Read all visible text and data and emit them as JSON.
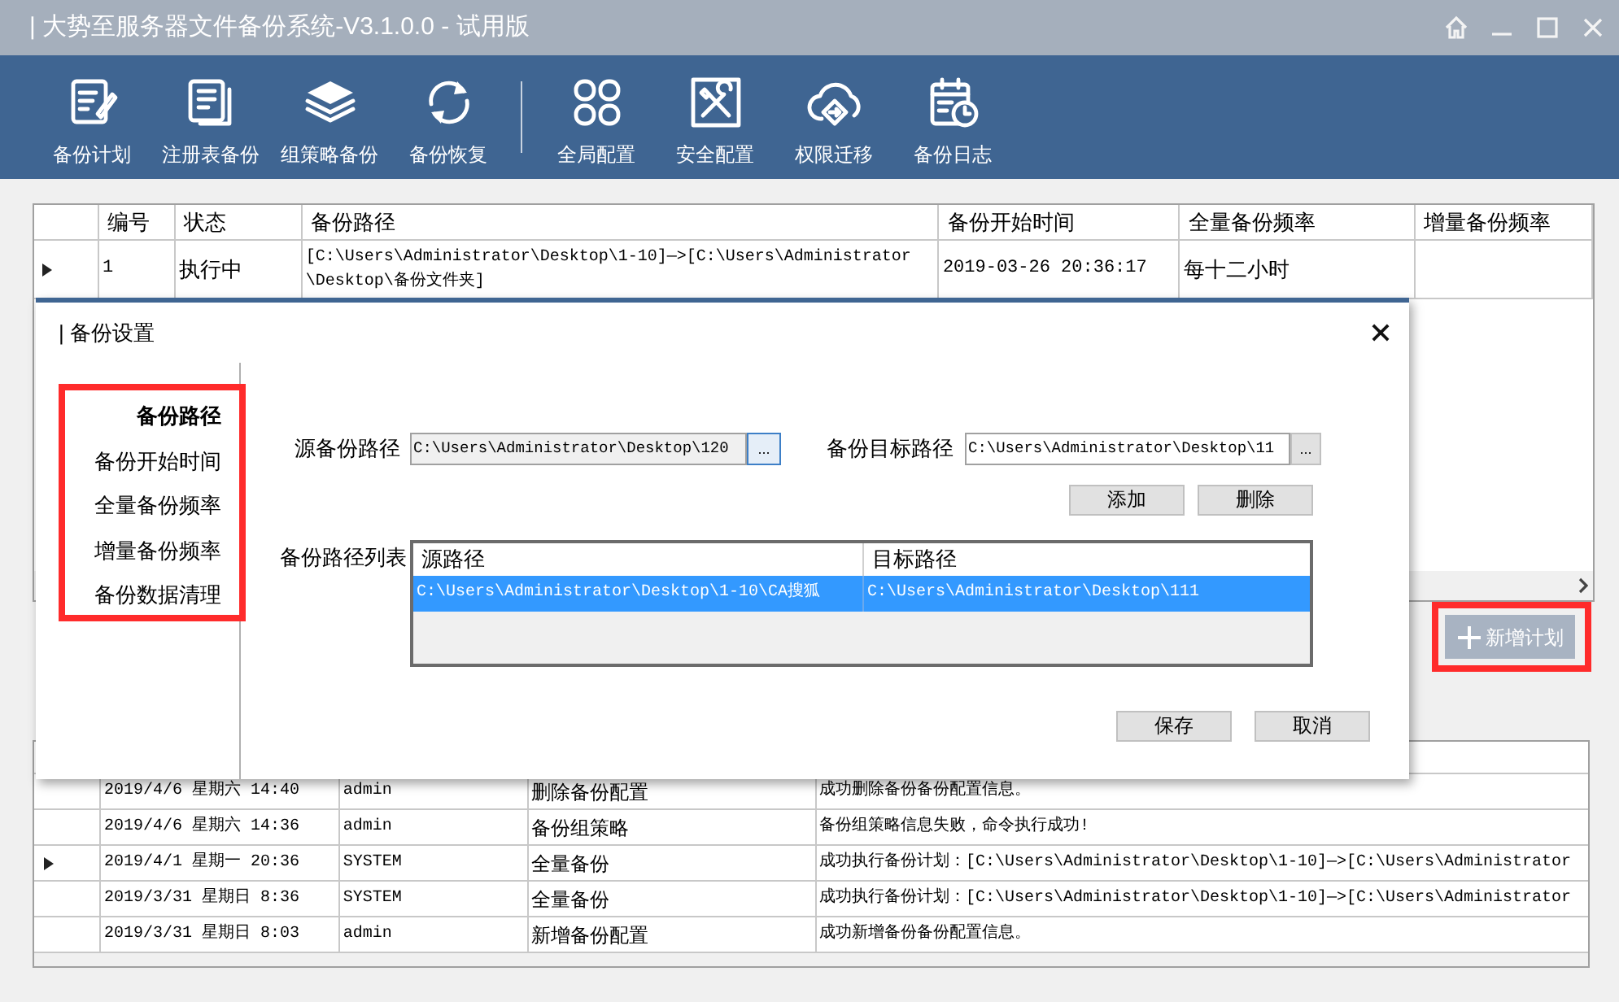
{
  "window": {
    "title": "| 大势至服务器文件备份系统-V3.1.0.0 - 试用版"
  },
  "toolbar": [
    {
      "label": "备份计划",
      "kind": "plan",
      "separator_before": false
    },
    {
      "label": "注册表备份",
      "kind": "pages",
      "separator_before": false
    },
    {
      "label": "组策略备份",
      "kind": "layers",
      "separator_before": false
    },
    {
      "label": "备份恢复",
      "kind": "sync",
      "separator_before": false
    },
    {
      "label": "全局配置",
      "kind": "grid",
      "separator_before": true
    },
    {
      "label": "安全配置",
      "kind": "tools",
      "separator_before": false
    },
    {
      "label": "权限迁移",
      "kind": "cloud",
      "separator_before": false
    },
    {
      "label": "备份日志",
      "kind": "calendar",
      "separator_before": false
    }
  ],
  "plans": {
    "columns": [
      "编号",
      "状态",
      "备份路径",
      "备份开始时间",
      "全量备份频率",
      "增量备份频率"
    ],
    "rows": [
      {
        "current": true,
        "cells": [
          "1",
          "执行中",
          "[C:\\Users\\Administrator\\Desktop\\1-10]—>[C:\\Users\\Administrator\\Desktop\\备份文件夹]",
          "2019-03-26 20:36:17",
          "每十二小时",
          ""
        ]
      }
    ]
  },
  "add_plan_button": {
    "label": "新增计划"
  },
  "dialog": {
    "title": "| 备份设置",
    "nav": [
      {
        "label": "备份路径",
        "selected": true
      },
      {
        "label": "备份开始时间",
        "selected": false
      },
      {
        "label": "全量备份频率",
        "selected": false
      },
      {
        "label": "增量备份频率",
        "selected": false
      },
      {
        "label": "备份数据清理",
        "selected": false
      }
    ],
    "source_label": "源备份路径",
    "source_value": "C:\\Users\\Administrator\\Desktop\\120",
    "browse_label": "...",
    "target_label": "备份目标路径",
    "target_value": "C:\\Users\\Administrator\\Desktop\\11",
    "target_browse_label": "...",
    "add_button": "添加",
    "delete_button": "删除",
    "list_label": "备份路径列表",
    "list": {
      "columns": [
        "源路径",
        "目标路径"
      ],
      "rows": [
        {
          "selected": true,
          "cells": [
            "C:\\Users\\Administrator\\Desktop\\1-10\\CA搜狐",
            "C:\\Users\\Administrator\\Desktop\\111"
          ]
        }
      ]
    },
    "save_button": "保存",
    "cancel_button": "取消"
  },
  "log": {
    "rows": [
      {
        "current": false,
        "cells": [
          "2019/4/6 星期六 14:40",
          "admin",
          "删除备份配置",
          "成功删除备份备份配置信息。"
        ]
      },
      {
        "current": false,
        "cells": [
          "2019/4/6 星期六 14:36",
          "admin",
          "备份组策略",
          "备份组策略信息失败，命令执行成功!"
        ]
      },
      {
        "current": true,
        "cells": [
          "2019/4/1 星期一 20:36",
          "SYSTEM",
          "全量备份",
          "成功执行备份计划：[C:\\Users\\Administrator\\Desktop\\1-10]—>[C:\\Users\\Administrator"
        ]
      },
      {
        "current": false,
        "cells": [
          "2019/3/31 星期日 8:36",
          "SYSTEM",
          "全量备份",
          "成功执行备份计划：[C:\\Users\\Administrator\\Desktop\\1-10]—>[C:\\Users\\Administrator"
        ]
      },
      {
        "current": false,
        "cells": [
          "2019/3/31 星期日 8:03",
          "admin",
          "新增备份配置",
          "成功新增备份备份配置信息。"
        ]
      }
    ]
  }
}
